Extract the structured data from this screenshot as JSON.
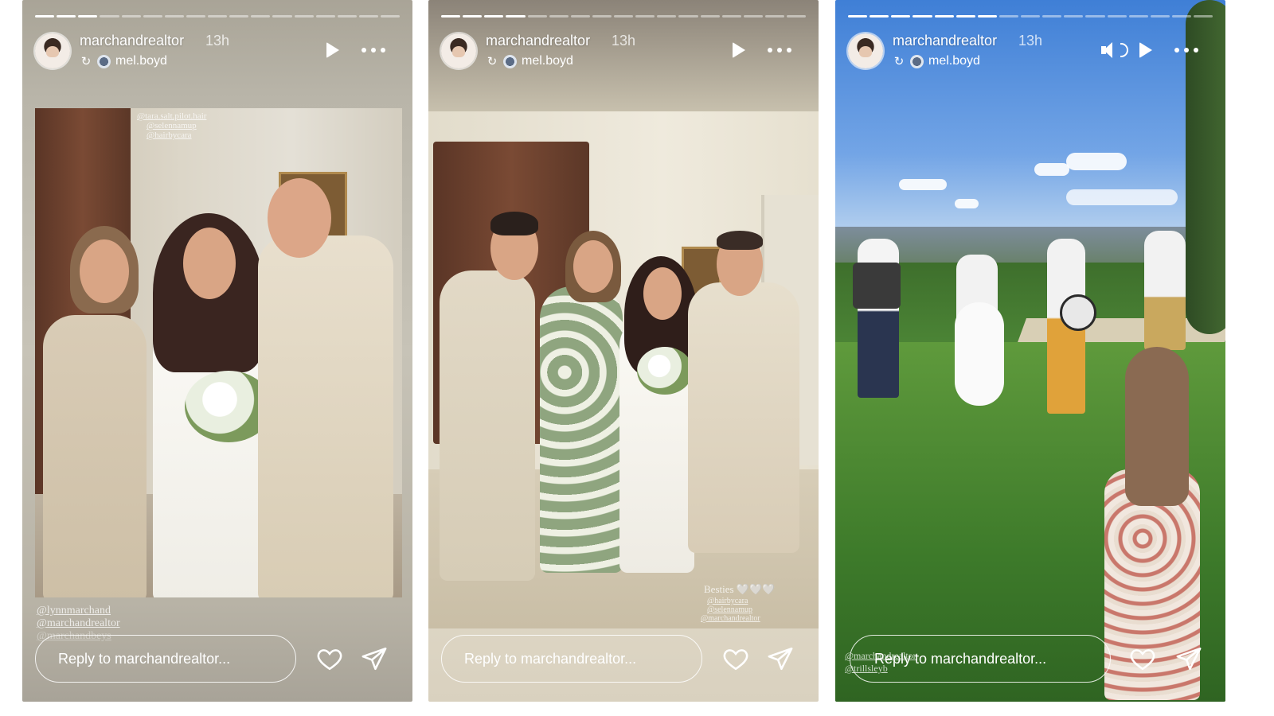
{
  "stories": [
    {
      "progress": {
        "total": 17,
        "done": 3
      },
      "username": "marchandrealtor",
      "time": "13h",
      "reposter": "mel.boyd",
      "tags_top": [
        "@tara.salt.pilot.hair",
        "@selennamup",
        "@hairbycara"
      ],
      "tags_bottom": [
        "@lynnmarchand",
        "@marchandrealtor",
        "@marchandbeys"
      ],
      "reply_placeholder": "Reply to marchandrealtor..."
    },
    {
      "progress": {
        "total": 17,
        "done": 4
      },
      "username": "marchandrealtor",
      "time": "13h",
      "reposter": "mel.boyd",
      "caption": "Besties 🤍🤍🤍",
      "tags_bottom": [
        "@hairbycara",
        "@selennamup",
        "@marchandrealtor"
      ],
      "reply_placeholder": "Reply to marchandrealtor..."
    },
    {
      "progress": {
        "total": 17,
        "done": 7
      },
      "username": "marchandrealtor",
      "time": "13h",
      "reposter": "mel.boyd",
      "tags_bottom": [
        "@marchandrealtor",
        "@trillsleyb"
      ],
      "reply_placeholder": "Reply to marchandrealtor..."
    }
  ],
  "icons": {
    "repost": "repost-icon",
    "play": "play-icon",
    "more": "more-icon",
    "sound": "sound-on-icon",
    "like": "heart-icon",
    "share": "send-icon"
  },
  "colors": {
    "text": "#ffffff",
    "page_bg": "#ffffff"
  }
}
